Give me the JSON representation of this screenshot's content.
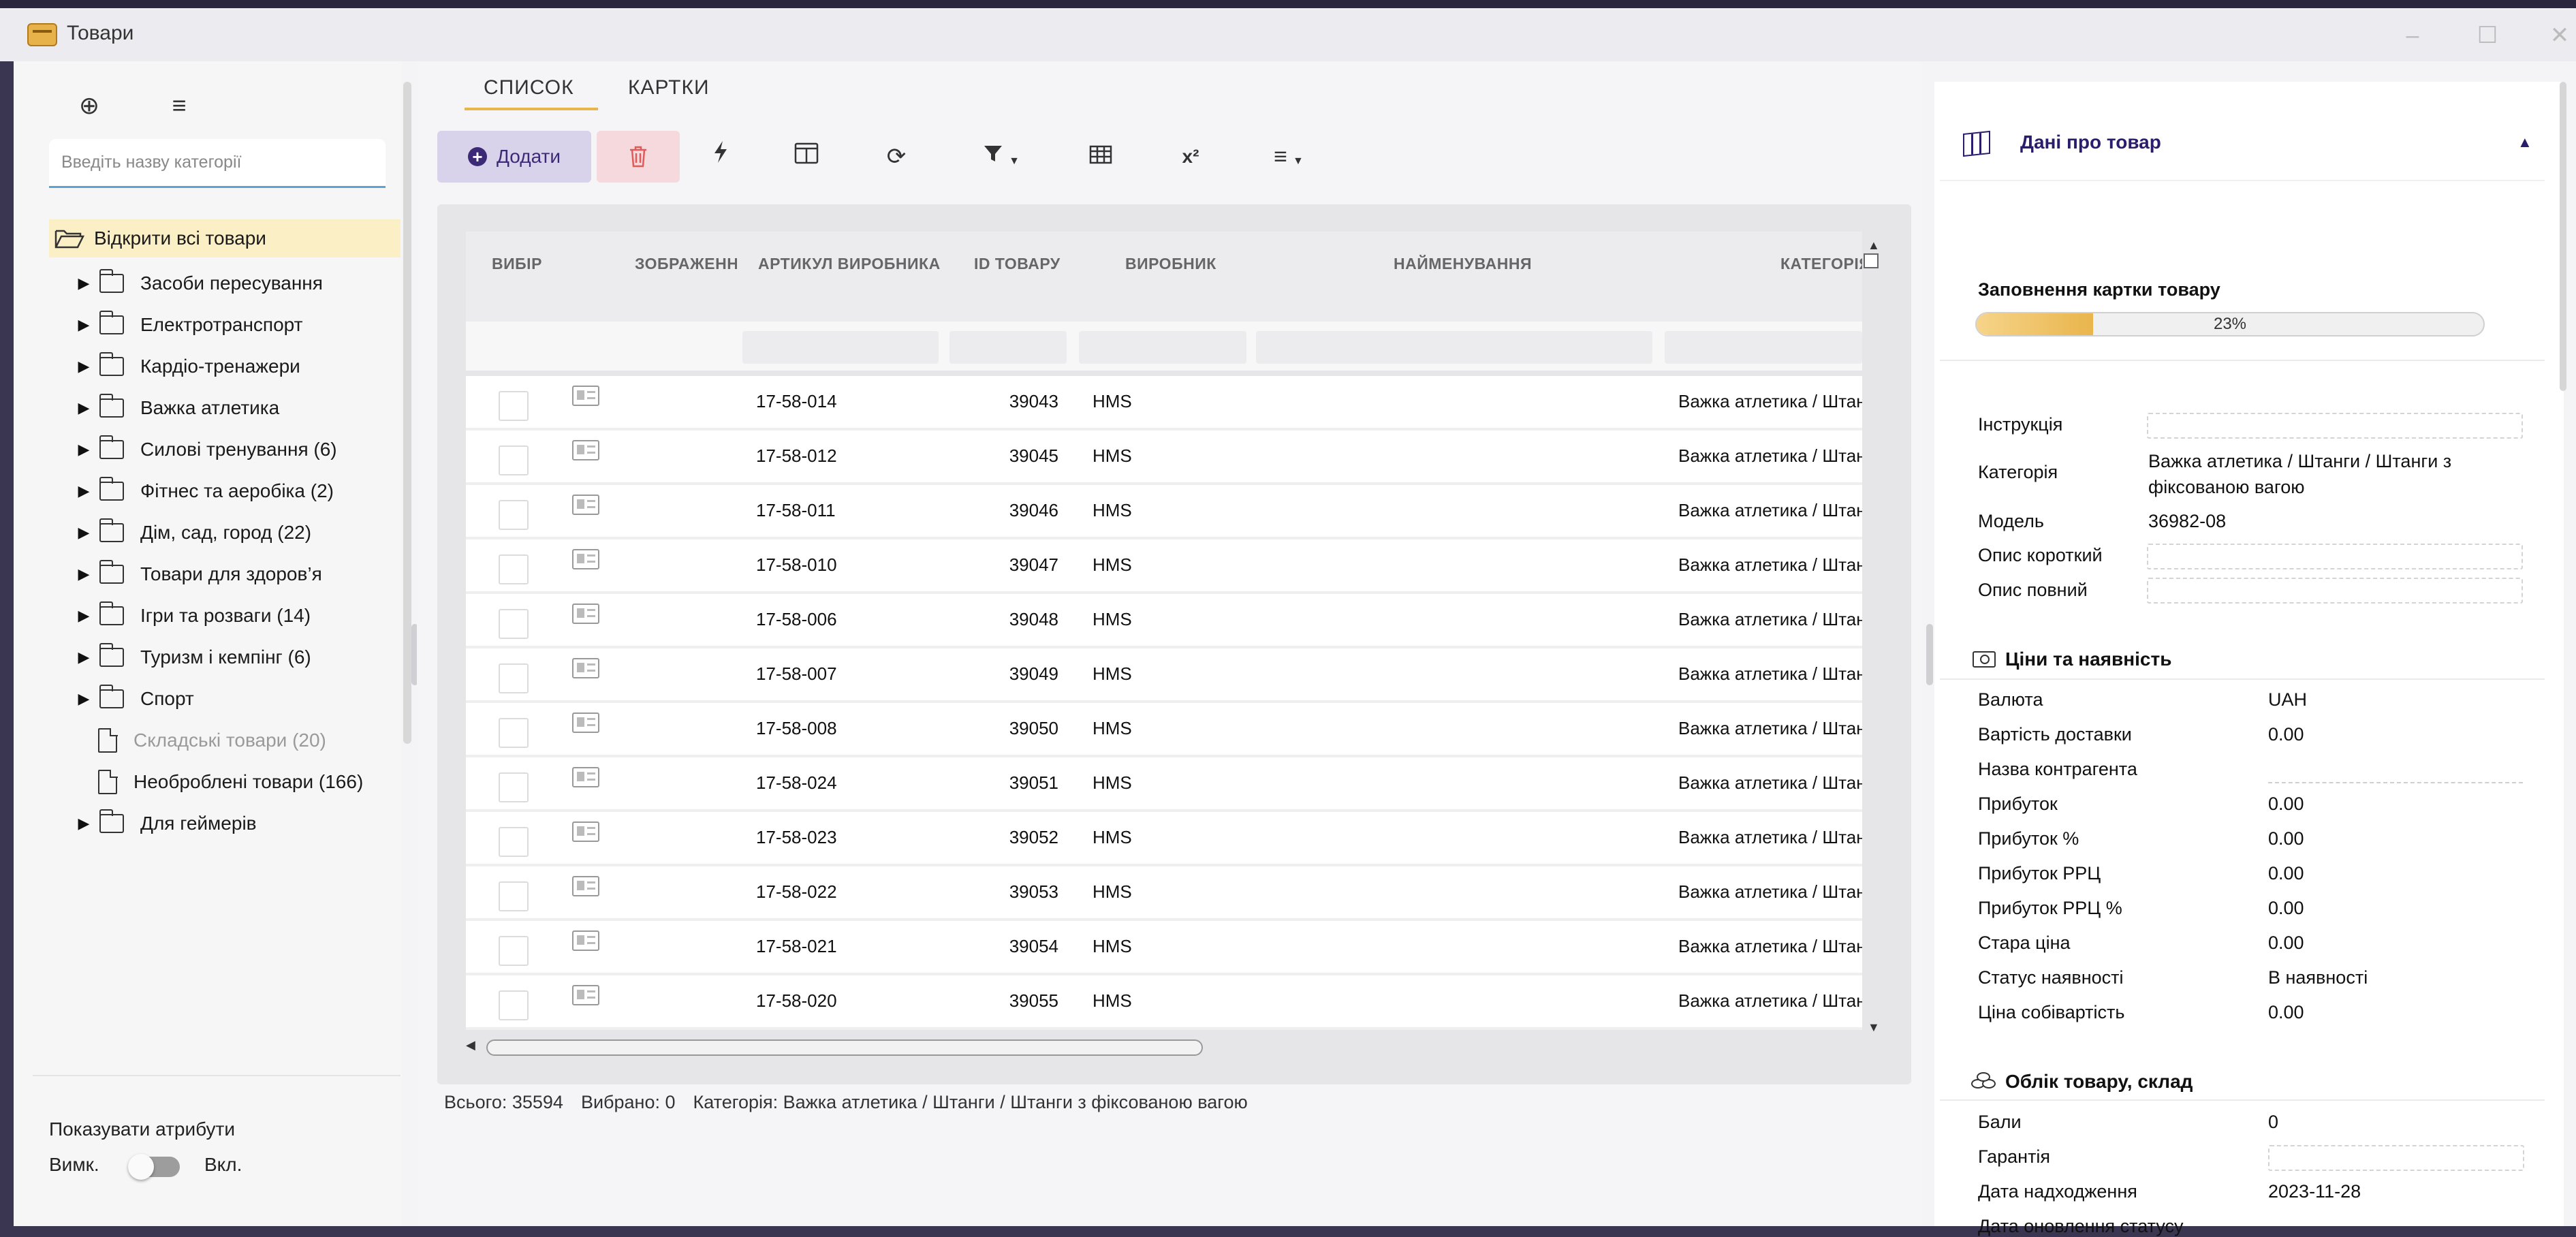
{
  "window": {
    "title": "Товари"
  },
  "sidebar": {
    "search_placeholder": "Введіть назву категорії",
    "open_all": "Відкрити всі товари",
    "items": [
      {
        "label": "Засоби пересування",
        "type": "folder"
      },
      {
        "label": "Електротранспорт",
        "type": "folder"
      },
      {
        "label": "Кардіо-тренажери",
        "type": "folder"
      },
      {
        "label": "Важка атлетика",
        "type": "folder"
      },
      {
        "label": "Силові тренування (6)",
        "type": "folder"
      },
      {
        "label": "Фітнес та аеробіка (2)",
        "type": "folder"
      },
      {
        "label": "Дім, сад, город (22)",
        "type": "folder"
      },
      {
        "label": "Товари для здоров’я",
        "type": "folder"
      },
      {
        "label": "Ігри та розваги (14)",
        "type": "folder"
      },
      {
        "label": "Туризм і кемпінг (6)",
        "type": "folder"
      },
      {
        "label": "Спорт",
        "type": "folder"
      },
      {
        "label": "Складські товари (20)",
        "type": "doc"
      },
      {
        "label": "Необроблені товари (166)",
        "type": "doc"
      },
      {
        "label": "Для геймерів",
        "type": "folder"
      }
    ],
    "show_attributes": "Показувати атрибути",
    "toggle_off": "Вимк.",
    "toggle_on": "Вкл."
  },
  "tabs": [
    "СПИСОК",
    "КАРТКИ"
  ],
  "toolbar": {
    "add_label": "Додати"
  },
  "table": {
    "columns": [
      "ВИБІР",
      "ЗОБРАЖЕННЯ",
      "АРТИКУЛ ВИРОБНИКА",
      "ID ТОВАРУ",
      "ВИРОБНИК",
      "НАЙМЕНУВАННЯ",
      "КАТЕГОРІЯ"
    ],
    "rows": [
      {
        "article": "17-58-014",
        "id": "39043",
        "maker": "HMS",
        "category": "Важка атлетика / Штанги"
      },
      {
        "article": "17-58-012",
        "id": "39045",
        "maker": "HMS",
        "category": "Важка атлетика / Штанги"
      },
      {
        "article": "17-58-011",
        "id": "39046",
        "maker": "HMS",
        "category": "Важка атлетика / Штанги"
      },
      {
        "article": "17-58-010",
        "id": "39047",
        "maker": "HMS",
        "category": "Важка атлетика / Штанги"
      },
      {
        "article": "17-58-006",
        "id": "39048",
        "maker": "HMS",
        "category": "Важка атлетика / Штанги"
      },
      {
        "article": "17-58-007",
        "id": "39049",
        "maker": "HMS",
        "category": "Важка атлетика / Штанги"
      },
      {
        "article": "17-58-008",
        "id": "39050",
        "maker": "HMS",
        "category": "Важка атлетика / Штанги"
      },
      {
        "article": "17-58-024",
        "id": "39051",
        "maker": "HMS",
        "category": "Важка атлетика / Штанги"
      },
      {
        "article": "17-58-023",
        "id": "39052",
        "maker": "HMS",
        "category": "Важка атлетика / Штанги"
      },
      {
        "article": "17-58-022",
        "id": "39053",
        "maker": "HMS",
        "category": "Важка атлетика / Штанги"
      },
      {
        "article": "17-58-021",
        "id": "39054",
        "maker": "HMS",
        "category": "Важка атлетика / Штанги"
      },
      {
        "article": "17-58-020",
        "id": "39055",
        "maker": "HMS",
        "category": "Важка атлетика / Штанги"
      }
    ]
  },
  "status": {
    "total": "Всього: 35594",
    "selected": "Вибрано: 0",
    "category": "Категорія: Важка атлетика / Штанги / Штанги з фіксованою вагою"
  },
  "details": {
    "header": "Дані про товар",
    "fill_label": "Заповнення картки товару",
    "fill_percent": 23,
    "fill_text": "23%",
    "fields": {
      "instruction": "Інструкція",
      "category_label": "Категорія",
      "category_value": "Важка атлетика / Штанги / Штанги з фіксованою вагою",
      "model_label": "Модель",
      "model_value": "36982-08",
      "short_desc": "Опис короткий",
      "full_desc": "Опис повний"
    },
    "prices": {
      "title": "Ціни та наявність",
      "rows": [
        {
          "label": "Валюта",
          "value": "UAH"
        },
        {
          "label": "Вартість доставки",
          "value": "0.00"
        },
        {
          "label": "Назва контрагента",
          "value": ""
        },
        {
          "label": "Прибуток",
          "value": "0.00"
        },
        {
          "label": "Прибуток %",
          "value": "0.00"
        },
        {
          "label": "Прибуток РРЦ",
          "value": "0.00"
        },
        {
          "label": "Прибуток РРЦ %",
          "value": "0.00"
        },
        {
          "label": "Стара ціна",
          "value": "0.00"
        },
        {
          "label": "Статус наявності",
          "value": "В наявності"
        },
        {
          "label": "Ціна собівартість",
          "value": "0.00"
        }
      ]
    },
    "stock": {
      "title": "Облік товару, склад",
      "rows": [
        {
          "label": "Бали",
          "value": "0"
        },
        {
          "label": "Гарантія",
          "value": ""
        },
        {
          "label": "Дата надходження",
          "value": "2023-11-28"
        },
        {
          "label": "Дата оновлення статусу",
          "value": ""
        }
      ]
    }
  }
}
